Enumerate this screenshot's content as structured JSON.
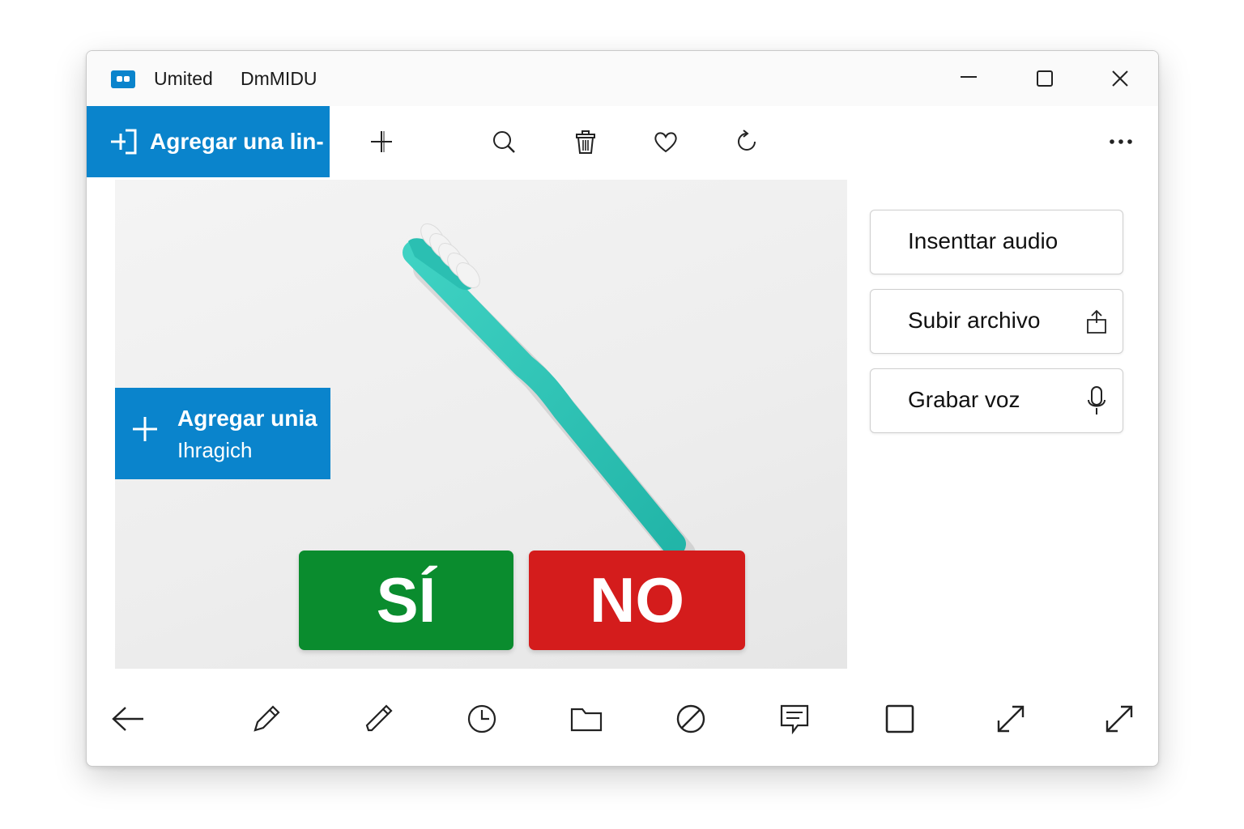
{
  "window": {
    "title_parts": [
      "Umited",
      "DmMIDU"
    ],
    "controls": {
      "minimize": "minimize-icon",
      "maximize": "maximize-icon",
      "close": "close-icon"
    }
  },
  "toolbar": {
    "primary_button": {
      "label": "Agregar una lin-",
      "icon": "add-line-icon"
    },
    "icons": [
      "plus-icon",
      "search-icon",
      "trash-icon",
      "heart-icon",
      "refresh-icon"
    ],
    "more": "more-icon"
  },
  "canvas": {
    "image_subject": "toothbrush",
    "accent_colors": {
      "toothbrush": "#2ec4b6",
      "bristles": "#f3f3f3"
    },
    "add_card": {
      "line1": "Agregar unia",
      "line2": "Ihragich",
      "icon": "plus-icon"
    },
    "answers": [
      {
        "label": "SÍ",
        "color": "#0a8c2e"
      },
      {
        "label": "NO",
        "color": "#d41c1c"
      }
    ]
  },
  "sidebar": {
    "buttons": [
      {
        "label": "Insenttar audio",
        "icon": ""
      },
      {
        "label": "Subir archivo",
        "icon": "upload-icon"
      },
      {
        "label": "Grabar voz",
        "icon": "microphone-icon"
      }
    ]
  },
  "bottom_toolbar": {
    "icons": [
      "back-arrow-icon",
      "pencil-icon",
      "marker-icon",
      "clock-icon",
      "folder-icon",
      "block-icon",
      "note-icon",
      "square-icon",
      "resize-icon",
      "expand-icon"
    ]
  },
  "colors": {
    "accent": "#0a84cc"
  }
}
